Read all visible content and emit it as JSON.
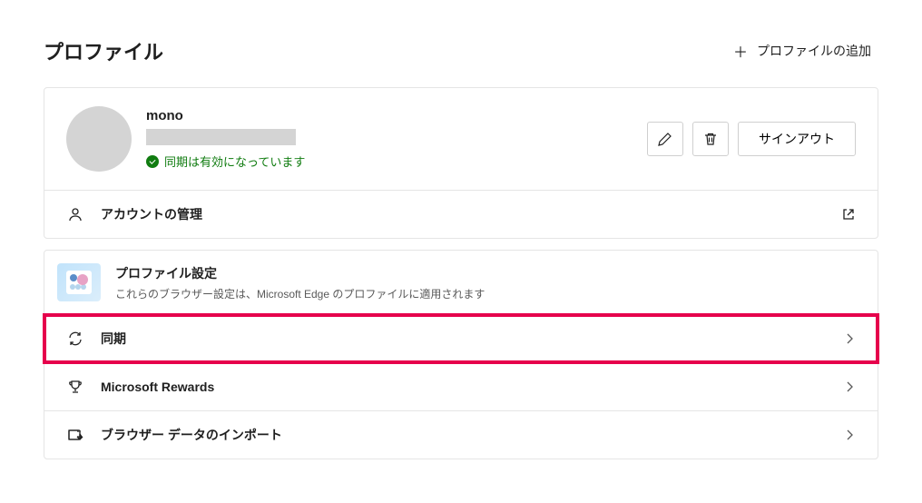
{
  "header": {
    "title": "プロファイル",
    "add_profile_label": "プロファイルの追加"
  },
  "profile": {
    "name": "mono",
    "sync_status": "同期は有効になっています",
    "signout_label": "サインアウト"
  },
  "account_manage": {
    "label": "アカウントの管理"
  },
  "settings_section": {
    "title": "プロファイル設定",
    "description": "これらのブラウザー設定は、Microsoft Edge のプロファイルに適用されます"
  },
  "menu": {
    "sync": "同期",
    "rewards": "Microsoft Rewards",
    "import": "ブラウザー データのインポート"
  }
}
